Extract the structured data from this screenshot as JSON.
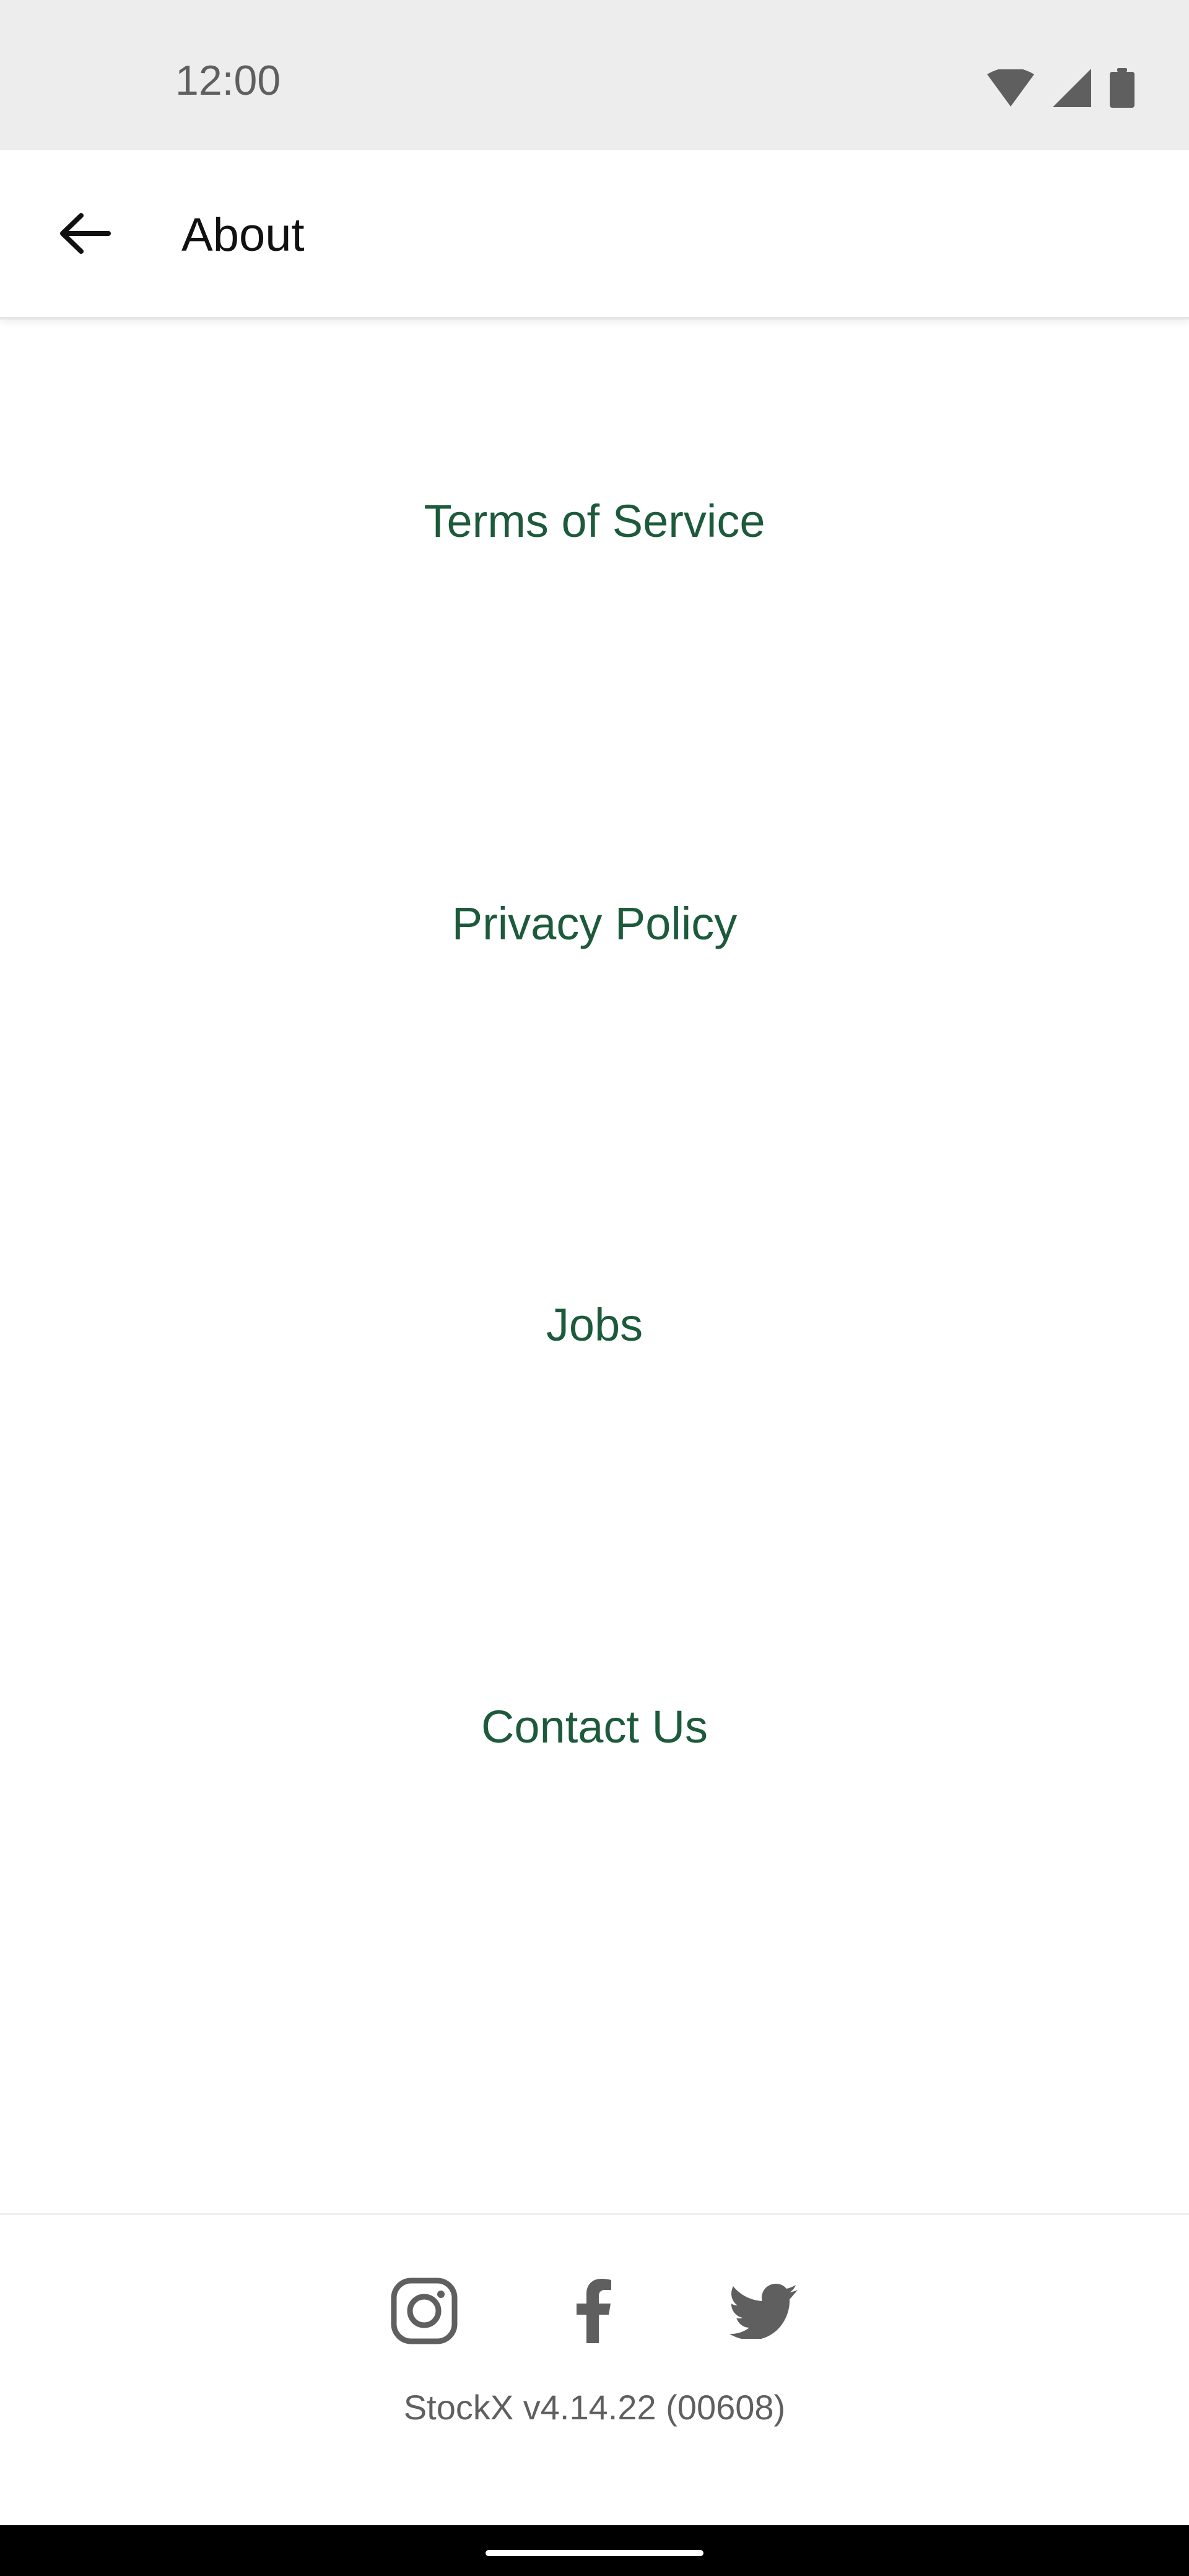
{
  "status_bar": {
    "time": "12:00",
    "icons": [
      "wifi-icon",
      "cellular-signal-icon",
      "battery-icon"
    ]
  },
  "app_bar": {
    "title": "About",
    "back_icon": "arrow-left-icon"
  },
  "links": [
    {
      "label": "Terms of Service"
    },
    {
      "label": "Privacy Policy"
    },
    {
      "label": "Jobs"
    },
    {
      "label": "Contact Us"
    }
  ],
  "footer": {
    "social": [
      "instagram-icon",
      "facebook-icon",
      "twitter-icon"
    ],
    "version": "StockX v4.14.22 (00608)"
  },
  "colors": {
    "link": "#1d5a3c",
    "status_bar_bg": "#ededed",
    "icon_gray": "#5f5f5f"
  }
}
